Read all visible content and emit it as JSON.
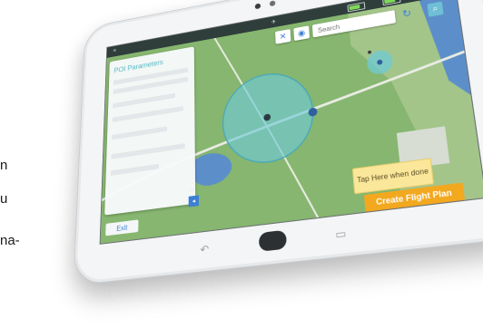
{
  "caption_text": {
    "line1": "n",
    "line2": "u",
    "line3": "na-"
  },
  "status_bar": {
    "items": [
      "",
      "",
      "",
      ""
    ]
  },
  "panel": {
    "title": "POI Parameters"
  },
  "search": {
    "placeholder": "Search"
  },
  "tooltip": {
    "text": "Tap Here when done"
  },
  "buttons": {
    "create_flight_plan": "Create Flight Plan",
    "exit": "Exit"
  },
  "colors": {
    "map_green": "#7fb069",
    "water": "#5c8fc9",
    "poi_circle": "#6ec9d4",
    "accent_blue": "#3d7fd6",
    "cta_orange": "#f2a81f",
    "tooltip_yellow": "#fbe79a"
  }
}
